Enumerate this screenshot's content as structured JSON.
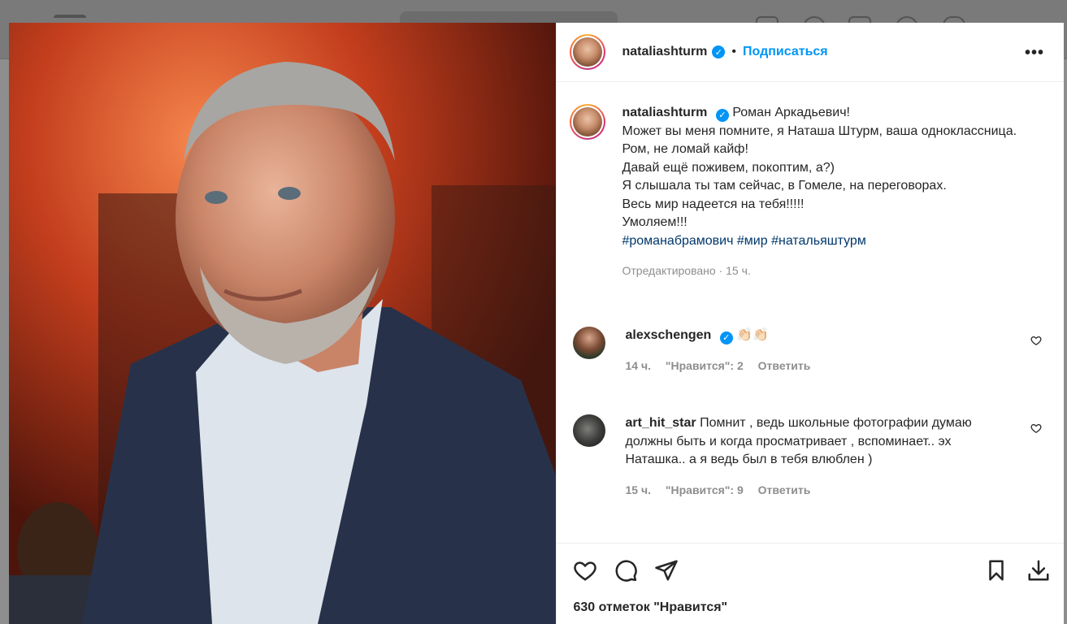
{
  "post": {
    "username": "nataliashturm",
    "follow_label": "Подписаться",
    "dot": "•",
    "more": "•••"
  },
  "caption": {
    "username": "nataliashturm",
    "lines": [
      "Роман Аркадьевич!",
      "Может вы меня помните, я Наташа Штурм, ваша одноклассница.",
      "Ром, не ломай кайф!",
      "Давай ещё поживем, покоптим, а?)",
      "Я слышала ты там сейчас, в Гомеле, на переговорах.",
      "Весь мир надеется на тебя!!!!!",
      "Умоляем!!!"
    ],
    "hashtags": [
      "#романабрамович",
      "#мир",
      "#натальяштурм"
    ],
    "meta": "Отредактировано · 15 ч."
  },
  "comments": [
    {
      "username": "alexschengen",
      "text": "👏🏻👏🏻",
      "time": "14 ч.",
      "likes": "\"Нравится\": 2",
      "reply": "Ответить"
    },
    {
      "username": "art_hit_star",
      "text": "Помнит , ведь школьные фотографии думаю должны быть и когда просматривает , вспоминает.. эх Наташка.. а я ведь был в тебя влюблен )",
      "time": "15 ч.",
      "likes": "\"Нравится\": 9",
      "reply": "Ответить"
    }
  ],
  "likes_count": "630 отметок \"Нравится\"",
  "icons": {
    "like": "heart-icon",
    "comment": "comment-icon",
    "share": "share-icon",
    "save": "bookmark-icon",
    "download": "download-icon",
    "more": "more-options-icon",
    "verified": "verified-badge-icon"
  },
  "colors": {
    "link_blue": "#0095f6",
    "hashtag": "#00376b",
    "muted": "#8e8e8e",
    "text": "#262626"
  }
}
